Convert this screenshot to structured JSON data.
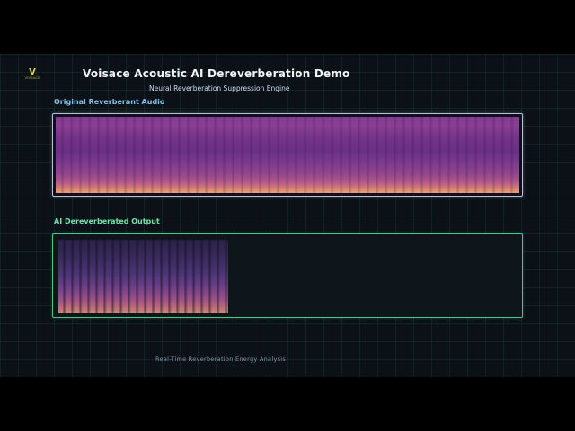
{
  "brand": {
    "mark": "V",
    "name": "VOISACE",
    "accent": "#d8d23a"
  },
  "header": {
    "title": "Voisace Acoustic AI Dereverberation Demo",
    "subtitle": "Neural Reverberation Suppression Engine"
  },
  "sections": {
    "original": {
      "label": "Original Reverberant Audio",
      "color": "#7fc0e8",
      "border_color": "#b9c3cb"
    },
    "output": {
      "label": "AI Dereverberated Output",
      "color": "#6ee6a8",
      "border_color": "#4fc98b",
      "progress": 0.37
    }
  },
  "footer": {
    "caption": "Real-Time Reverberation Energy Analysis"
  }
}
